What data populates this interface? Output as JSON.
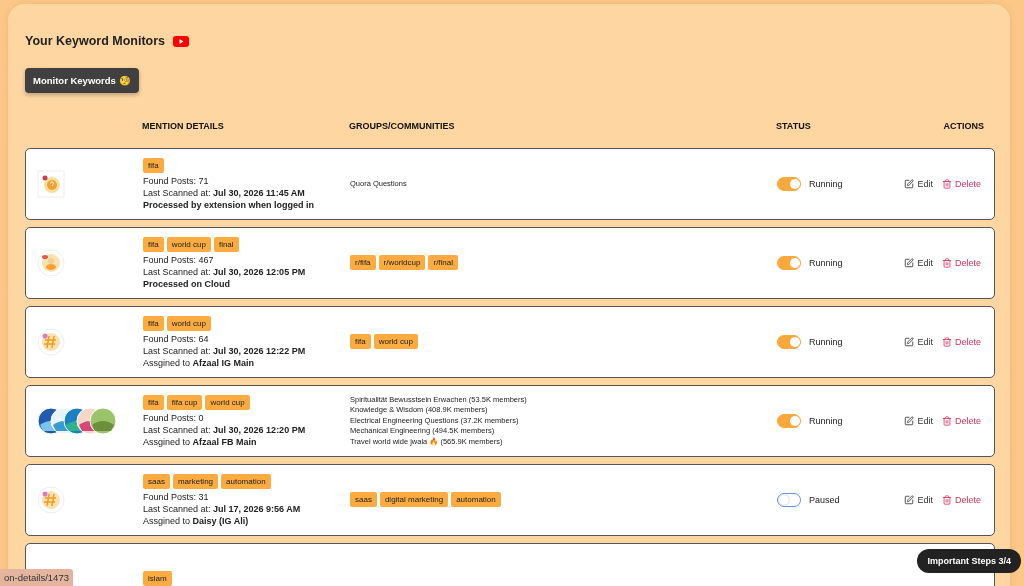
{
  "title": "Your Keyword Monitors",
  "monitor_button": "Monitor Keywords 🧐",
  "columns": [
    "MENTION DETAILS",
    "GROUPS/COMMUNITIES",
    "STATUS",
    "ACTIONS"
  ],
  "monitors": [
    {
      "avatar": {
        "kind": "question"
      },
      "keywords": [
        "fifa"
      ],
      "found": "Found Posts: 71",
      "scanned_label": "Last Scanned at:",
      "scanned": "Jul 30, 2026 11:45 AM",
      "note": {
        "text": "Processed by extension when logged in",
        "bold": true
      },
      "groups": {
        "kind": "lines",
        "items": [
          "Quora Questions"
        ]
      },
      "running": true,
      "status": "Running",
      "edit": "Edit",
      "delete": "Delete"
    },
    {
      "avatar": {
        "kind": "blob"
      },
      "keywords": [
        "fifa",
        "world cup",
        "final"
      ],
      "found": "Found Posts: 467",
      "scanned_label": "Last Scanned at:",
      "scanned": "Jul 30, 2026 12:05 PM",
      "note": {
        "text": "Processed on Cloud",
        "bold": true
      },
      "groups": {
        "kind": "tags",
        "items": [
          "r/fifa",
          "r/worldcup",
          "r/final"
        ]
      },
      "running": true,
      "status": "Running",
      "edit": "Edit",
      "delete": "Delete"
    },
    {
      "avatar": {
        "kind": "hashtag"
      },
      "keywords": [
        "fifa",
        "world cup"
      ],
      "found": "Found Posts: 64",
      "scanned_label": "Last Scanned at:",
      "scanned": "Jul 30, 2026 12:22 PM",
      "note": {
        "text": "Assgined to **Afzaal IG Main**",
        "bold": false
      },
      "groups": {
        "kind": "tags",
        "items": [
          "fifa",
          "world cup"
        ]
      },
      "running": true,
      "status": "Running",
      "edit": "Edit",
      "delete": "Delete"
    },
    {
      "avatar": {
        "kind": "photos"
      },
      "keywords": [
        "fifa",
        "fifa cup",
        "world cup"
      ],
      "found": "Found Posts: 0",
      "scanned_label": "Last Scanned at:",
      "scanned": "Jul 30, 2026 12:20 PM",
      "note": {
        "text": "Assgined to **Afzaal FB Main**",
        "bold": false
      },
      "groups": {
        "kind": "lines",
        "items": [
          "Spiritualität Bewusstsein Erwachen (53.5K members)",
          "Knowledge & Wisdom (408.9K members)",
          "Electrical Engineering Questions (37.2K members)",
          "Mechanical Engineering (494.5K members)",
          "Travel world wide jwala 🔥 (565.9K members)"
        ]
      },
      "running": true,
      "status": "Running",
      "edit": "Edit",
      "delete": "Delete"
    },
    {
      "avatar": {
        "kind": "hashtag"
      },
      "keywords": [
        "saas",
        "marketing",
        "automation"
      ],
      "found": "Found Posts: 31",
      "scanned_label": "Last Scanned at:",
      "scanned": "Jul 17, 2026 9:56 AM",
      "note": {
        "text": "Assgined to **Daisy (IG Ali)**",
        "bold": false
      },
      "groups": {
        "kind": "tags",
        "items": [
          "saas",
          "digital marketing",
          "automation"
        ]
      },
      "running": false,
      "status": "Paused",
      "edit": "Edit",
      "delete": "Delete"
    },
    {
      "keywords": [
        "islam"
      ]
    }
  ],
  "status_url": "on-details/1473",
  "steps_badge": "Important Steps 3/4"
}
